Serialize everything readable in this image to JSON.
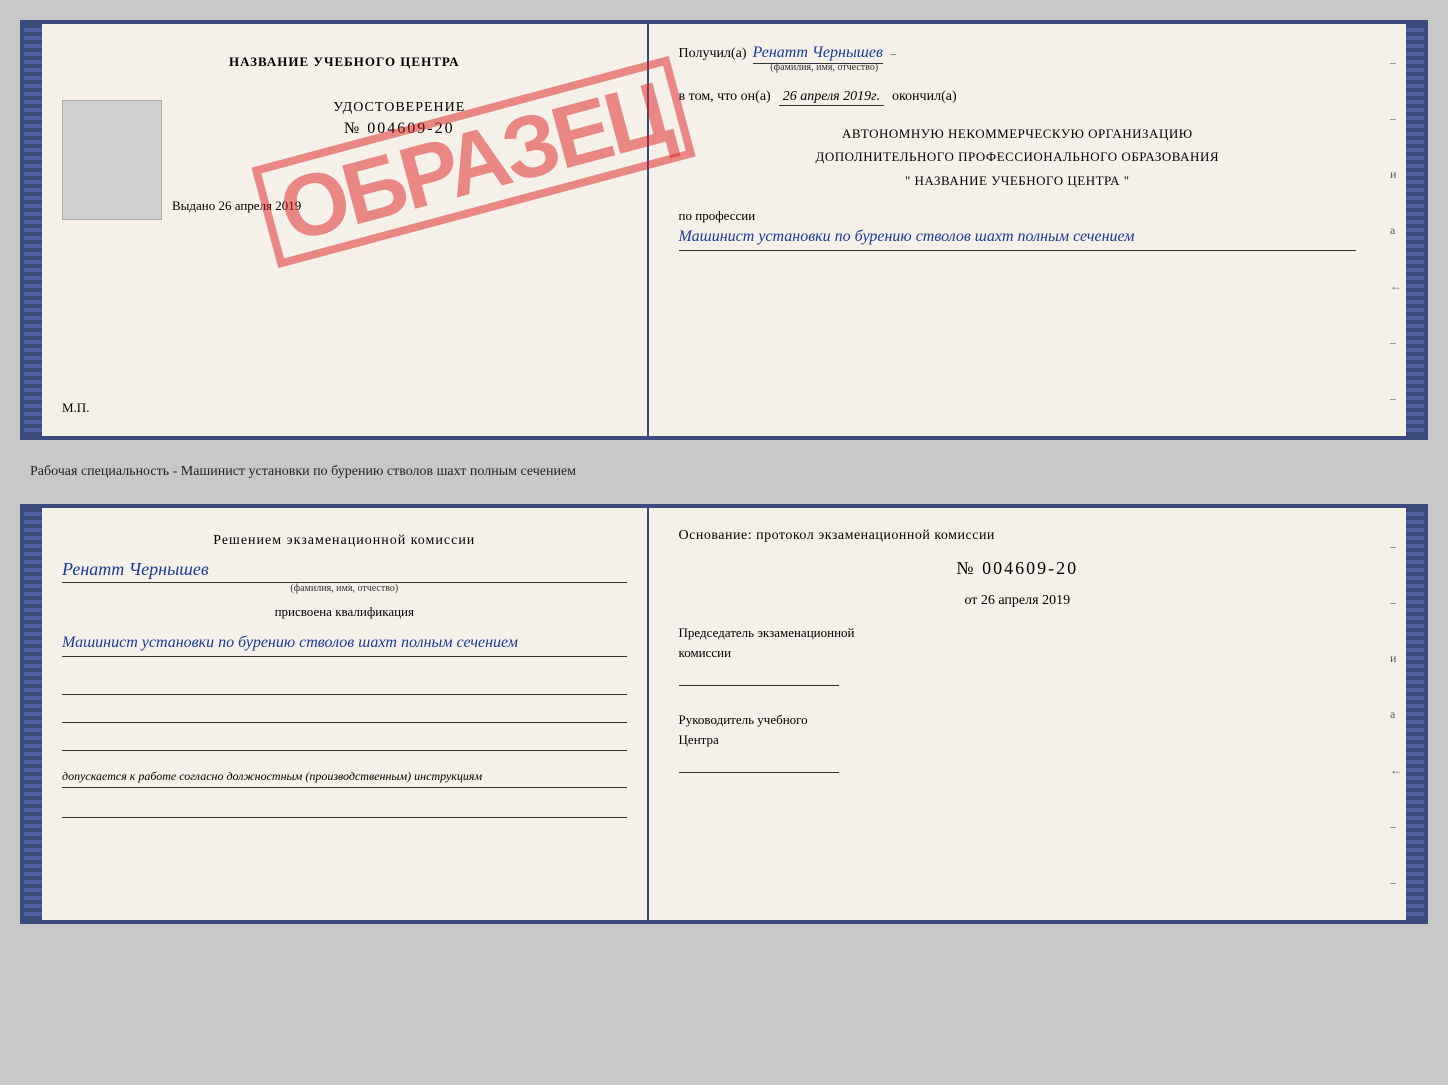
{
  "top_cert": {
    "left": {
      "school_title": "НАЗВАНИЕ УЧЕБНОГО ЦЕНТРА",
      "udost_label": "УДОСТОВЕРЕНИЕ",
      "udost_number": "№ 004609-20",
      "stamp": "ОБРАЗЕЦ",
      "vydano": "Выдано 26 апреля 2019",
      "mp": "М.П."
    },
    "right": {
      "poluchil_label": "Получил(а)",
      "poluchil_name": "Ренатт Чернышев",
      "fio_label": "(фамилия, имя, отчество)",
      "vtom_label": "в том, что он(а)",
      "vtom_date": "26 апреля 2019г.",
      "okonchil": "окончил(а)",
      "org_line1": "АВТОНОМНУЮ НЕКОММЕРЧЕСКУЮ ОРГАНИЗАЦИЮ",
      "org_line2": "ДОПОЛНИТЕЛЬНОГО ПРОФЕССИОНАЛЬНОГО ОБРАЗОВАНИЯ",
      "org_line3": "\"  НАЗВАНИЕ УЧЕБНОГО ЦЕНТРА  \"",
      "po_professii": "по профессии",
      "profession": "Машинист установки по бурению стволов шахт полным сечением",
      "side_dashes": [
        "–",
        "–",
        "и",
        "а",
        "←",
        "–",
        "–"
      ]
    }
  },
  "specialty_text": "Рабочая специальность - Машинист установки по бурению стволов шахт полным сечением",
  "bottom_cert": {
    "left": {
      "resheniyem": "Решением экзаменационной комиссии",
      "person_name": "Ренатт Чернышев",
      "fio_label": "(фамилия, имя, отчество)",
      "prisvoena": "присвоена квалификация",
      "qualification": "Машинист установки по бурению стволов шахт полным сечением",
      "dopuskaetsya": "допускается к  работе согласно должностным (производственным) инструкциям"
    },
    "right": {
      "osnovaniye": "Основание: протокол экзаменационной комиссии",
      "number_prefix": "№",
      "number": "004609-20",
      "ot_label": "от",
      "ot_date": "26 апреля 2019",
      "predsedatel_line1": "Председатель экзаменационной",
      "predsedatel_line2": "комиссии",
      "rukovoditel_line1": "Руководитель учебного",
      "rukovoditel_line2": "Центра",
      "side_dashes": [
        "–",
        "–",
        "и",
        "а",
        "←",
        "–",
        "–"
      ]
    }
  }
}
